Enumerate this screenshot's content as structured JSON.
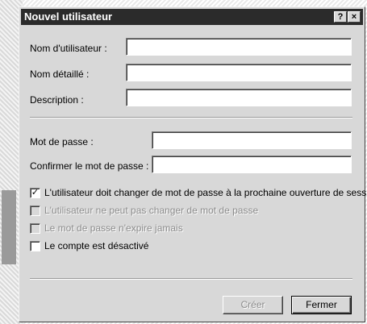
{
  "window": {
    "title": "Nouvel utilisateur",
    "help_glyph": "?",
    "close_glyph": "×"
  },
  "form": {
    "username_label": "Nom d'utilisateur :",
    "username_value": "",
    "fullname_label": "Nom détaillé :",
    "fullname_value": "",
    "description_label": "Description :",
    "description_value": "",
    "password_label": "Mot de passe :",
    "password_value": "",
    "confirm_label": "Confirmer le mot de passe :",
    "confirm_value": ""
  },
  "options": [
    {
      "label": "L'utilisateur doit changer de mot de passe à la prochaine ouverture de session",
      "checked": true,
      "enabled": true,
      "mark": "✓"
    },
    {
      "label": "L'utilisateur ne peut pas changer de mot de passe",
      "checked": false,
      "enabled": false,
      "mark": ""
    },
    {
      "label": "Le mot de passe n'expire jamais",
      "checked": false,
      "enabled": false,
      "mark": ""
    },
    {
      "label": "Le compte est désactivé",
      "checked": false,
      "enabled": true,
      "mark": ""
    }
  ],
  "buttons": {
    "create_label": "Créer",
    "create_enabled": false,
    "close_label": "Fermer"
  }
}
